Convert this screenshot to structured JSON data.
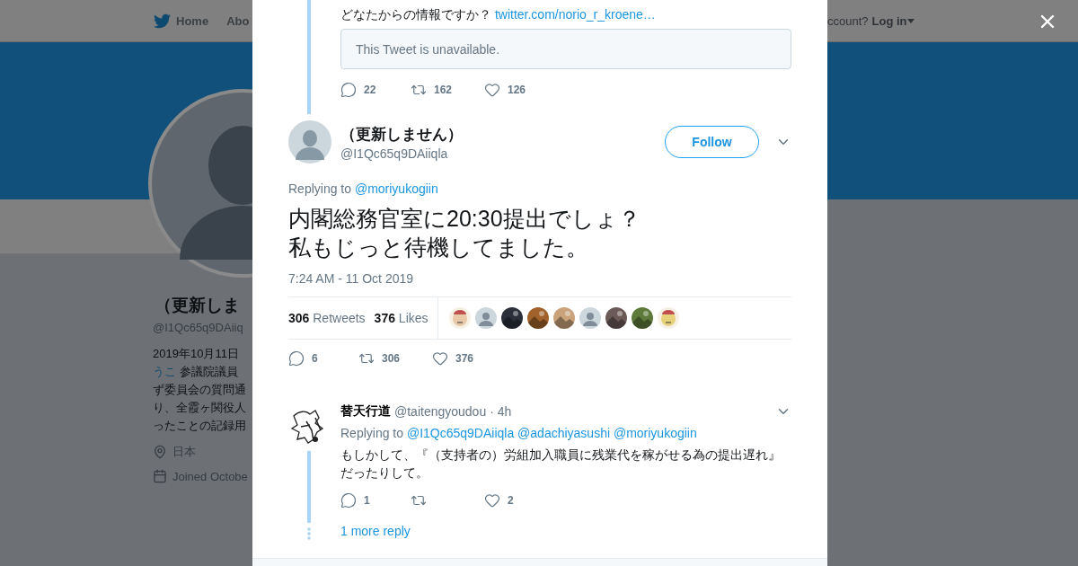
{
  "background": {
    "nav": [
      {
        "label": "Home"
      },
      {
        "label": "Abo"
      }
    ],
    "login": {
      "prompt": "ccount?",
      "action": "Log in"
    },
    "profile": {
      "name": "（更新しま",
      "handle": "@I1Qc65q9DAiiq",
      "bio": [
        {
          "text": "2019年10月11日"
        },
        {
          "link": "うこ",
          "text": " 参議院議員"
        },
        {
          "text": "ず委員会の質問通"
        },
        {
          "text": "り、全霞ヶ関役人"
        },
        {
          "text": "ったことの記録用"
        }
      ],
      "location": "日本",
      "joined": "Joined Octobe"
    }
  },
  "previous_tweet": {
    "text": "どなたからの情報ですか？",
    "link": "twitter.com/norio_r_kroene…",
    "quote": "This Tweet is unavailable.",
    "actions": {
      "reply": "22",
      "retweet": "162",
      "like": "126"
    }
  },
  "tweet": {
    "name": "（更新しません）",
    "handle": "@I1Qc65q9DAiiqla",
    "follow": "Follow",
    "replying_label": "Replying to",
    "replying_to": [
      "@moriyukogiin"
    ],
    "text": [
      "内閣総務官室に20:30提出でしょ？",
      "私もじっと待機してました。"
    ],
    "timestamp": "7:24 AM - 11 Oct 2019",
    "stats": [
      {
        "count": "306",
        "label": "Retweets"
      },
      {
        "count": "376",
        "label": "Likes"
      }
    ],
    "likers": [
      {
        "kind": "cartoon",
        "color": "#e8c9a8"
      },
      {
        "kind": "default",
        "color": "#ccd6dd"
      },
      {
        "kind": "picture",
        "color": "#2a2f3a"
      },
      {
        "kind": "picture",
        "color": "#a0622a"
      },
      {
        "kind": "picture",
        "color": "#c9a27a"
      },
      {
        "kind": "default",
        "color": "#ccd6dd"
      },
      {
        "kind": "picture",
        "color": "#6b5a58"
      },
      {
        "kind": "picture",
        "color": "#5d7a3a"
      },
      {
        "kind": "cartoon",
        "color": "#e6d27a"
      }
    ],
    "actions": {
      "reply": "6",
      "retweet": "306",
      "like": "376"
    }
  },
  "reply": {
    "name": "替天行道",
    "handle": "@taitengyoudou",
    "time": "· 4h",
    "replying_label": "Replying to",
    "replying_to": [
      "@I1Qc65q9DAiiqla",
      "@adachiyasushi",
      "@moriyukogiin"
    ],
    "text": [
      "もしかして、『（支持者の）労組加入職員に残業代を稼がせる為の提出遅れ』",
      "だったりして。"
    ],
    "actions": {
      "reply": "1",
      "like": "2"
    },
    "more": "1 more reply"
  }
}
